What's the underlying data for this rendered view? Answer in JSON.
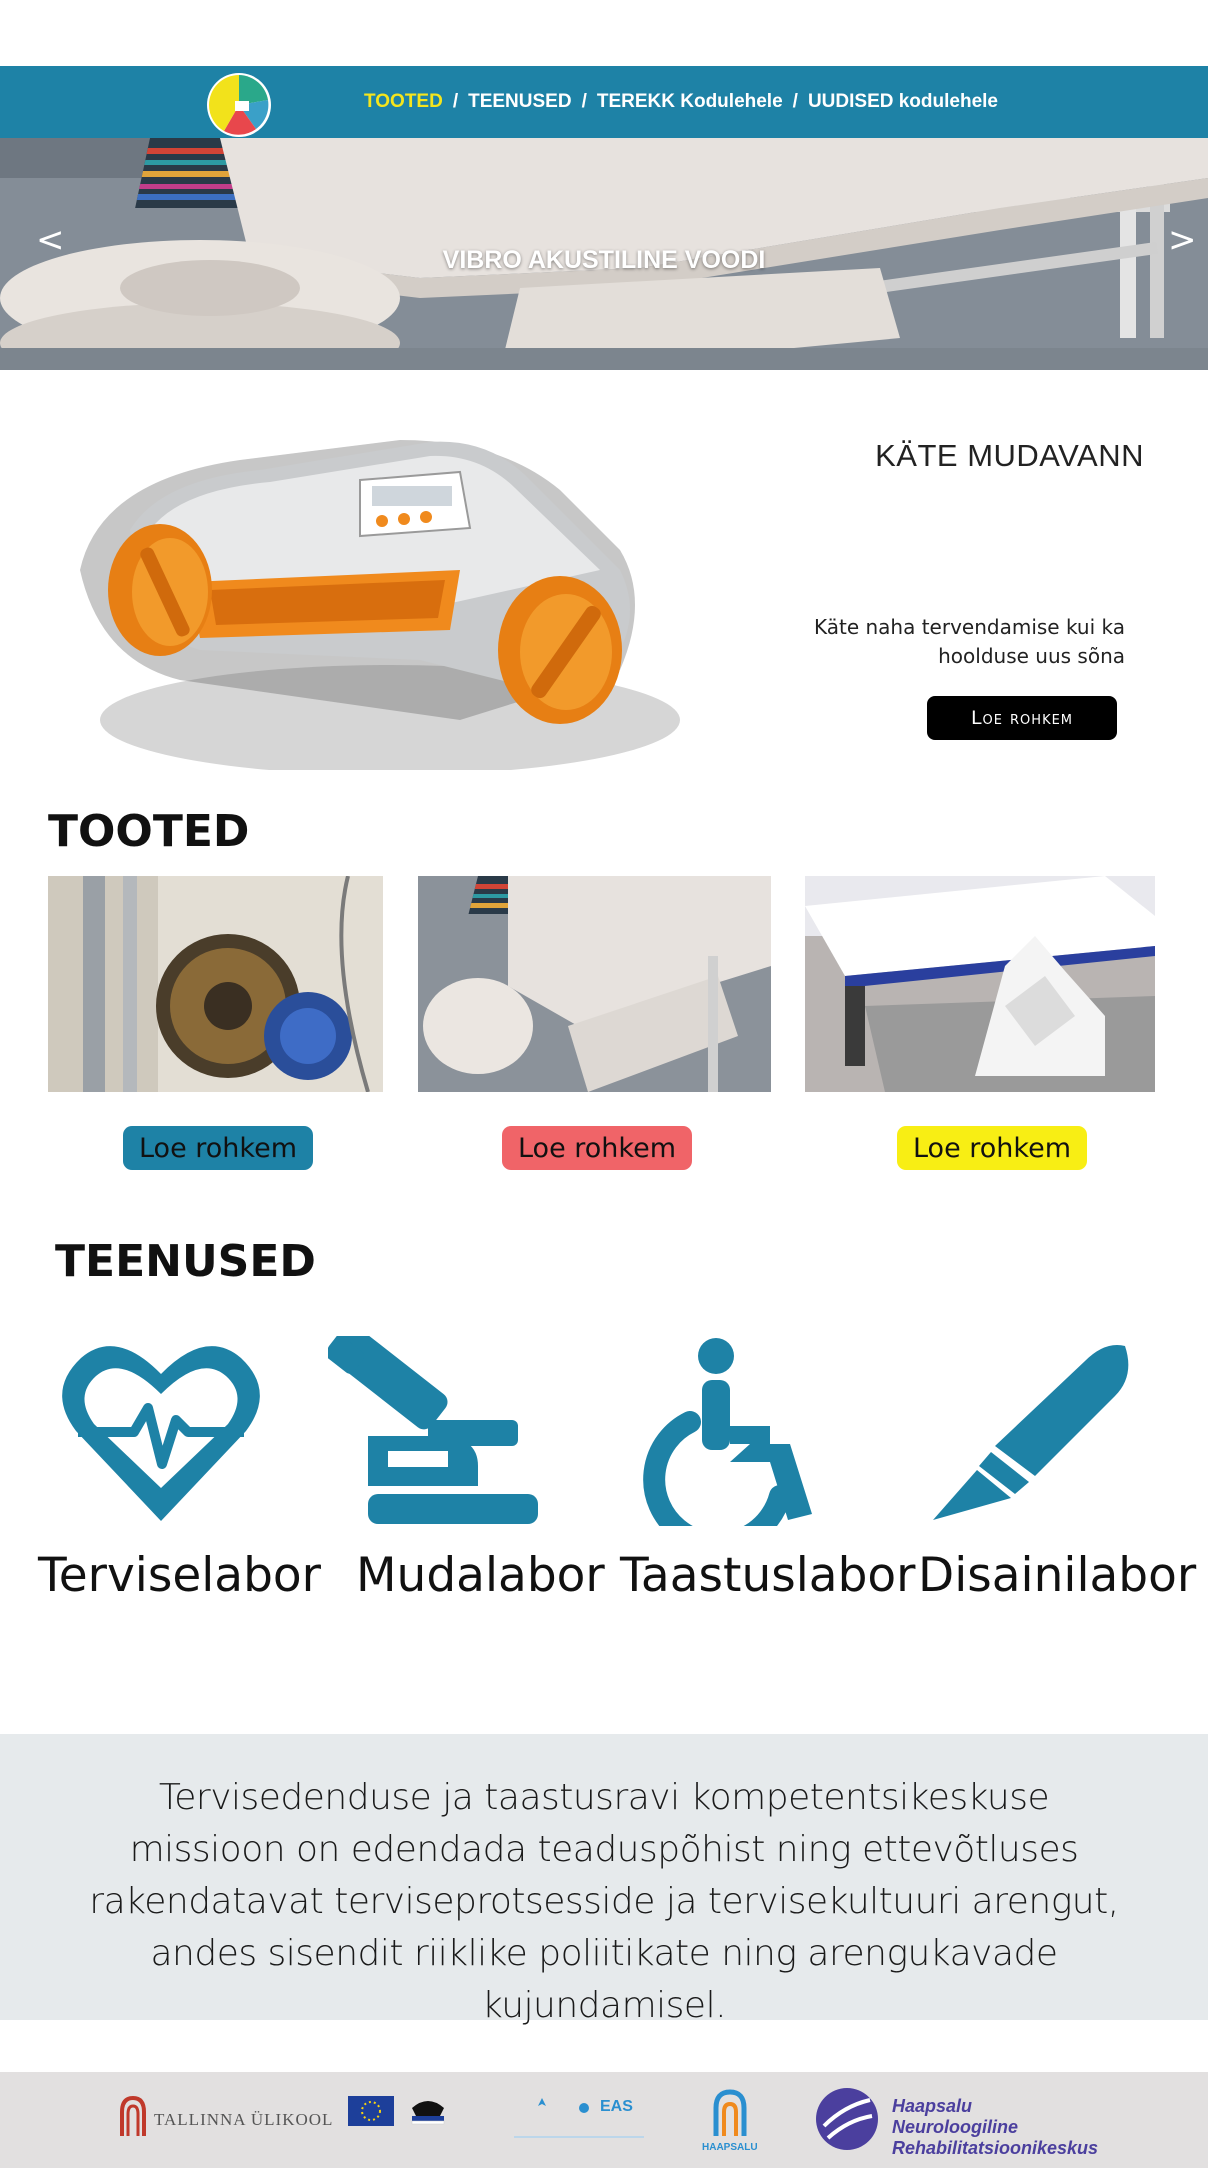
{
  "nav": {
    "items": [
      {
        "label": "TOOTED",
        "active": true
      },
      {
        "label": "TEENUSED",
        "active": false
      },
      {
        "label": "TEREKK Kodulehele",
        "active": false
      },
      {
        "label": "UUDISED kodulehele",
        "active": false
      }
    ],
    "separator": "/",
    "colors": {
      "bar": "#1e82a6",
      "active": "#f5e51d",
      "text": "#ffffff"
    }
  },
  "hero": {
    "caption": "VIBRO AKUSTILINE VOODI",
    "prev": "<",
    "next": ">"
  },
  "feature": {
    "title": "KÄTE MUDAVANN",
    "description": "Käte naha tervendamise kui ka hoolduse uus sõna",
    "button": "Loe rohkem"
  },
  "products": {
    "heading": "TOOTED",
    "items": [
      {
        "button": "Loe rohkem",
        "button_color": "#1e82a6"
      },
      {
        "button": "Loe rohkem",
        "button_color": "#f06468"
      },
      {
        "button": "Loe rohkem",
        "button_color": "#f8ee14"
      }
    ]
  },
  "services": {
    "heading": "TEENUSED",
    "icon_color": "#1e82a6",
    "items": [
      {
        "label": "Terviselabor",
        "icon": "heart-pulse-icon"
      },
      {
        "label": "Mudalabor",
        "icon": "microscope-icon"
      },
      {
        "label": "Taastuslabor",
        "icon": "wheelchair-icon"
      },
      {
        "label": "Disainilabor",
        "icon": "scalpel-icon"
      }
    ]
  },
  "mission": {
    "lines": [
      "Tervisedenduse ja taastusravi kompetentsikeskuse",
      "missioon on edendada teaduspõhist ning ettevõtluses",
      "rakendatavat terviseprotsesside ja tervisekultuuri arengut,",
      "andes sisendit riiklike poliitikate ning arengukavade kujundamisel."
    ]
  },
  "partners": {
    "tallinn": "TALLINNA ÜLIKOOL",
    "eas": "EAS",
    "haapsalu_small": "HAAPSALU",
    "hnrk": [
      "Haapsalu",
      "Neuroloogiline",
      "Rehabilitatsioonikeskus"
    ]
  }
}
